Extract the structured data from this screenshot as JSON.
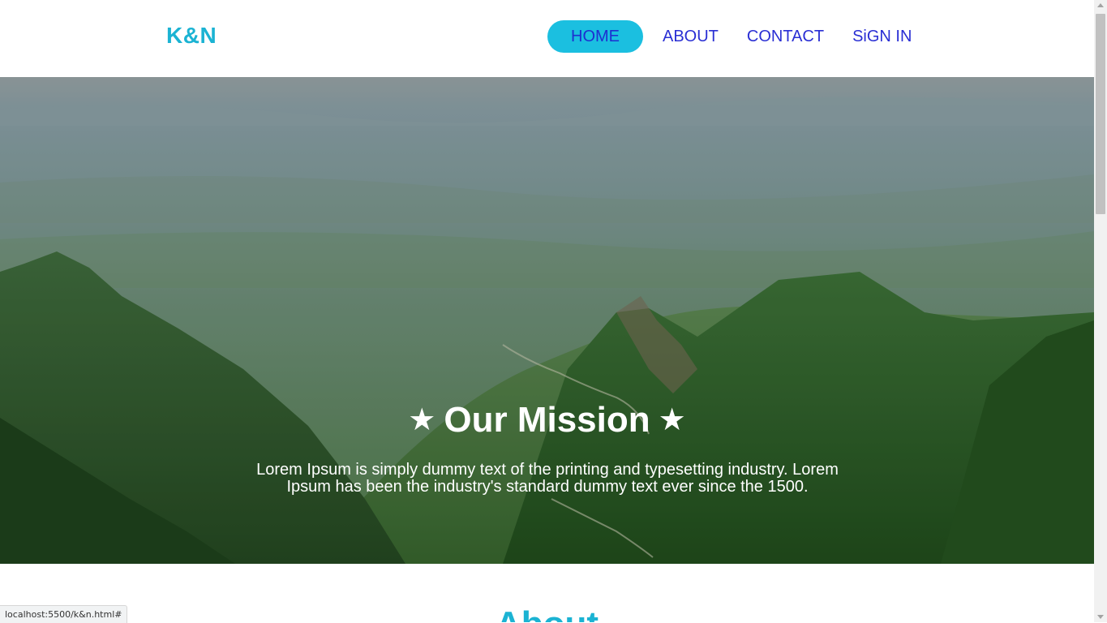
{
  "nav": {
    "brand": "K&N",
    "links": [
      "HOME",
      "ABOUT",
      "CONTACT",
      "SiGN IN"
    ],
    "active": "HOME"
  },
  "hero": {
    "title": "Our Mission",
    "star_icon": "★",
    "text": "Lorem Ipsum is simply dummy text of the printing and typesetting industry. Lorem Ipsum has been the industry's standard dummy text ever since the 1500."
  },
  "about": {
    "heading": "About"
  },
  "status_bar": {
    "url": "localhost:5500/k&n.html#"
  },
  "colors": {
    "brand": "#1bb3d3",
    "nav_link": "#2a2fd4",
    "active_pill": "#1bbfe0"
  }
}
